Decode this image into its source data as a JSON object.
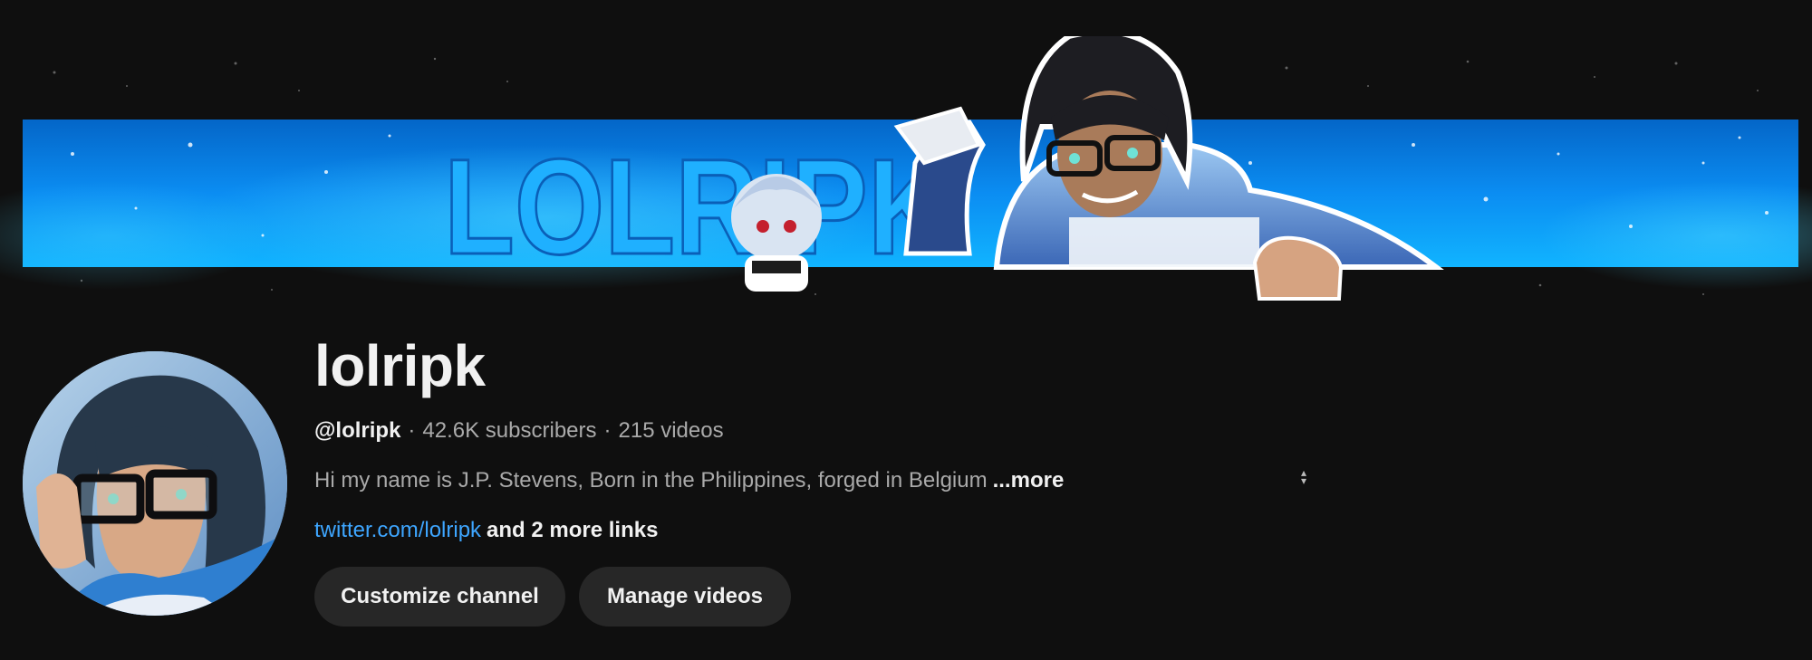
{
  "banner": {
    "wordmark": "LOLRIPK"
  },
  "channel": {
    "title": "lolripk",
    "handle": "@lolripk",
    "separator": "·",
    "subscribers": "42.6K subscribers",
    "videos": "215 videos",
    "description": "Hi my name is J.P. Stevens, Born in the Philippines, forged in Belgium",
    "more_label": "...more",
    "link_text": "twitter.com/lolripk",
    "more_links_label": "and 2 more links"
  },
  "buttons": {
    "customize": "Customize channel",
    "manage": "Manage videos"
  },
  "colors": {
    "background": "#0f0f0f",
    "link": "#3ea6ff",
    "button_bg": "#272727",
    "banner_blue": "#0a8cf0"
  }
}
